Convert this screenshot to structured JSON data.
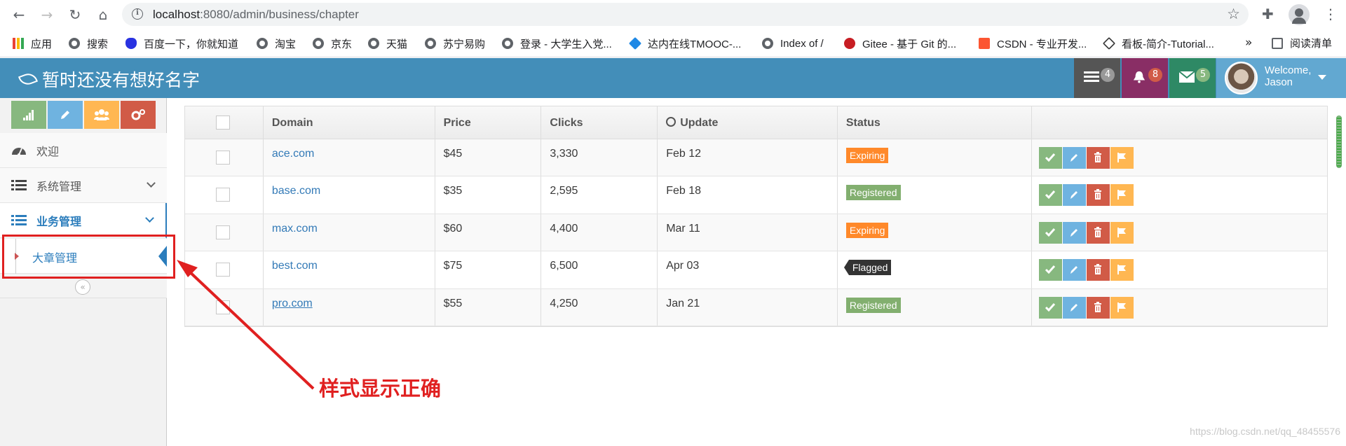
{
  "browser": {
    "url_host": "localhost",
    "url_rest": ":8080/admin/business/chapter",
    "bookmarks": [
      "应用",
      "搜索",
      "百度一下，你就知道",
      "淘宝",
      "京东",
      "天猫",
      "苏宁易购",
      "登录 - 大学生入党...",
      "达内在线TMOOC-...",
      "Index of /",
      "Gitee - 基于 Git 的...",
      "CSDN - 专业开发...",
      "看板-简介-Tutorial..."
    ],
    "more": "»",
    "reading_list": "阅读清单"
  },
  "navbar": {
    "brand": "暂时还没有想好名字",
    "tasks_count": "4",
    "notifications_count": "8",
    "messages_count": "5",
    "welcome": "Welcome,",
    "username": "Jason"
  },
  "sidebar": {
    "items": [
      {
        "label": "欢迎"
      },
      {
        "label": "系统管理"
      },
      {
        "label": "业务管理"
      }
    ],
    "submenu": {
      "label": "大章管理"
    }
  },
  "table": {
    "headers": [
      "Domain",
      "Price",
      "Clicks",
      "Update",
      "Status"
    ],
    "rows": [
      {
        "domain": "ace.com",
        "price": "$45",
        "clicks": "3,330",
        "update": "Feb 12",
        "status": "Expiring",
        "status_color": "#ff892a"
      },
      {
        "domain": "base.com",
        "price": "$35",
        "clicks": "2,595",
        "update": "Feb 18",
        "status": "Registered",
        "status_color": "#82af6f"
      },
      {
        "domain": "max.com",
        "price": "$60",
        "clicks": "4,400",
        "update": "Mar 11",
        "status": "Expiring",
        "status_color": "#ff892a"
      },
      {
        "domain": "best.com",
        "price": "$75",
        "clicks": "6,500",
        "update": "Apr 03",
        "status": "Flagged",
        "status_color": "#333333"
      },
      {
        "domain": "pro.com",
        "price": "$55",
        "clicks": "4,250",
        "update": "Jan 21",
        "status": "Registered",
        "status_color": "#82af6f"
      }
    ]
  },
  "annotation": {
    "text": "样式显示正确"
  },
  "watermark": "https://blog.csdn.net/qq_48455576",
  "colors": {
    "navbar": "#438eb9",
    "success": "#87b87f",
    "info": "#6fb3e0",
    "danger": "#d15b47",
    "warning": "#ffb752",
    "link": "#2b7dbc"
  }
}
